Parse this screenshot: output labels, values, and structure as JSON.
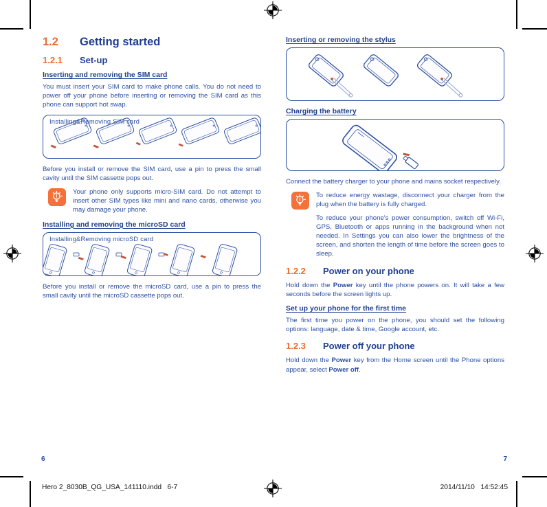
{
  "document": {
    "page_left_number": "6",
    "page_right_number": "7",
    "footer": {
      "file_label": "Hero 2_8030B_QG_USA_141110.indd   6-7",
      "timestamp": "2014/11/10   14:52:45"
    },
    "colors": {
      "accent_orange": "#ED6B2D",
      "heading_blue": "#1F3F8F",
      "body_blue": "#2B4EA2",
      "tip_icon_bg": "#F5713A"
    }
  },
  "left_page": {
    "section_heading": {
      "number": "1.2",
      "title": "Getting started"
    },
    "subsection_heading": {
      "number": "1.2.1",
      "title": "Set-up"
    },
    "sim_heading": "Inserting and removing the SIM card",
    "sim_paragraph": "You must insert your SIM card to make phone calls. You do not need to power off your phone before inserting or removing the SIM card as this phone can support hot swap.",
    "sim_illustration_caption": "Installing&Removing SIM card",
    "sim_after_paragraph": "Before you install or remove the SIM card, use a pin to press the small cavity until the SIM cassette pops out.",
    "sim_tip": "Your phone only supports micro-SIM card. Do not attempt to insert other SIM types like mini and nano cards, otherwise you may damage your phone.",
    "microsd_heading": "Installing and removing the microSD card",
    "microsd_illustration_caption": "Installing&Removing microSD card",
    "microsd_after_paragraph": "Before you install or remove the microSD card, use a pin to press the small cavity until the microSD cassette pops out."
  },
  "right_page": {
    "stylus_heading": "Inserting or removing the stylus",
    "charging_heading": "Charging the battery",
    "charging_paragraph": "Connect the battery charger to your phone and mains socket respectively.",
    "charging_tip_1": "To reduce energy wastage, disconnect your charger from the plug when the battery is fully charged.",
    "charging_tip_2": "To reduce your phone's power consumption, switch off Wi-Fi, GPS, Bluetooth or apps running in the background when not needed. In Settings you can also lower the brightness of the screen, and shorten the length of time before the screen goes to sleep.",
    "power_on_heading": {
      "number": "1.2.2",
      "title": "Power on your phone"
    },
    "power_on_paragraph_pre": "Hold down the ",
    "power_on_keyword": "Power",
    "power_on_paragraph_post": " key until the phone powers on. It will take a few seconds before the screen lights up.",
    "first_time_heading": "Set up your phone for the first time",
    "first_time_paragraph": "The first time you power on the phone, you should set the following options: language, date & time, Google account, etc.",
    "power_off_heading": {
      "number": "1.2.3",
      "title": "Power off your phone"
    },
    "power_off_pre": "Hold down the ",
    "power_off_kw1": "Power",
    "power_off_mid": " key from the Home screen until the Phone options appear, select ",
    "power_off_kw2": "Power off",
    "power_off_post": "."
  }
}
